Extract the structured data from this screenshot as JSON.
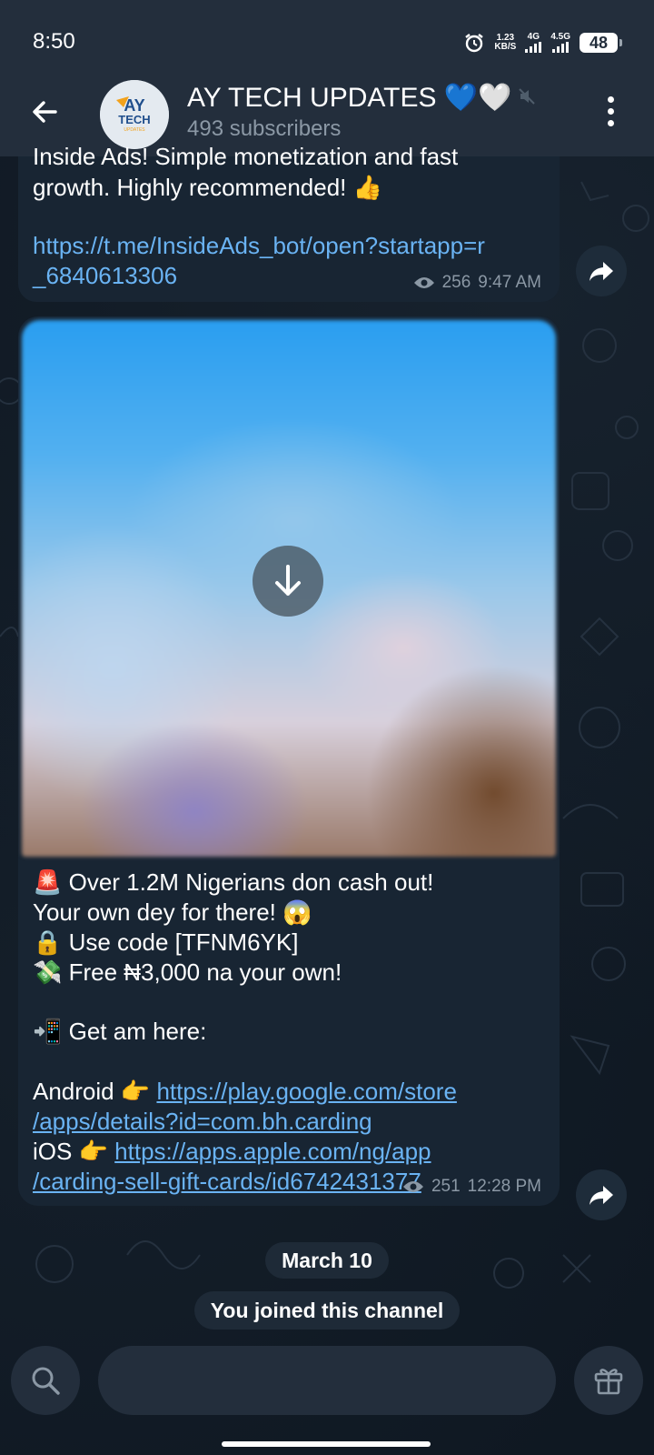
{
  "status_bar": {
    "time": "8:50",
    "net_speed_value": "1.23",
    "net_speed_unit": "KB/S",
    "network_1": "4G",
    "network_2": "4.5G",
    "battery": "48"
  },
  "header": {
    "channel_name": "AY TECH UPDATES 💙🤍",
    "subscribers": "493 subscribers",
    "avatar_text_top": "AY",
    "avatar_text_mid": "TECH",
    "avatar_text_bottom": "UPDATES"
  },
  "messages": [
    {
      "line1": "Inside Ads! Simple monetization and fast",
      "line2": "growth. Highly recommended! 👍",
      "link_line1": "https://t.me/InsideAds_bot/open?startapp=r",
      "link_line2": "_6840613306",
      "views": "256",
      "time": "9:47 AM"
    },
    {
      "line1": "🚨 Over 1.2M Nigerians don cash out!",
      "line2": "Your own dey for there! 😱",
      "line3": "🔒 Use code [TFNM6YK]",
      "line4": "💸 Free ₦3,000 na your own!",
      "line5": "📲 Get am here:",
      "android_label": "Android 👉 ",
      "android_link_1": "https://play.google.com/store",
      "android_link_2": "/apps/details?id=com.bh.carding",
      "ios_label": "iOS 👉 ",
      "ios_link_1": "https://apps.apple.com/ng/app",
      "ios_link_2": "/carding-sell-gift-cards/id6742431377",
      "views": "251",
      "time": "12:28 PM"
    }
  ],
  "date_pill": "March 10",
  "service_message": "You joined this channel",
  "input": {
    "placeholder": ""
  },
  "colors": {
    "header_bg": "#232e3c",
    "bubble_bg": "#182533",
    "link": "#6ab3f3",
    "meta": "#8b98a5"
  },
  "icons": [
    "back-arrow-icon",
    "mute-icon",
    "more-vertical-icon",
    "eye-icon",
    "forward-icon",
    "download-icon",
    "search-icon",
    "gift-icon",
    "alarm-icon",
    "signal-icon",
    "battery-icon"
  ]
}
